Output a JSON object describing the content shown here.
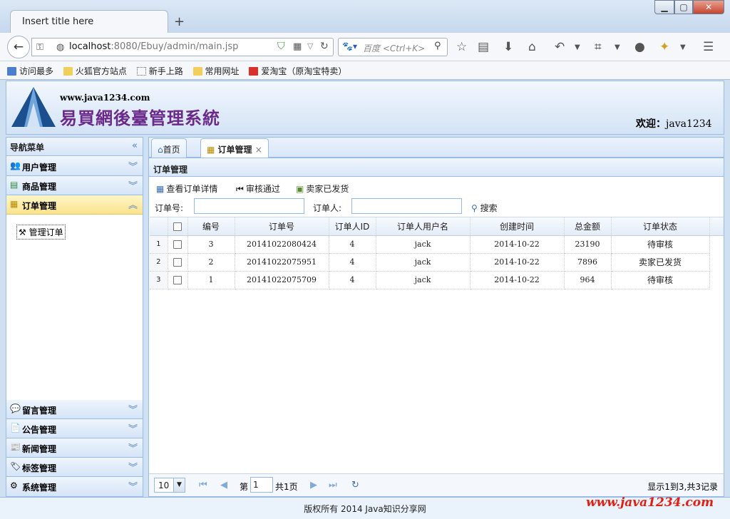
{
  "browser": {
    "tab_title": "Insert title here",
    "new_tab": "+",
    "url_host": "localhost",
    "url_rest": ":8080/Ebuy/admin/main.jsp",
    "search_placeholder": "百度 <Ctrl+K>",
    "bookmarks": [
      "访问最多",
      "火狐官方站点",
      "新手上路",
      "常用网址",
      "爱淘宝（原淘宝特卖）"
    ]
  },
  "header": {
    "site_url": "www.java1234.com",
    "system_title": "易買網後臺管理系統",
    "welcome_label": "欢迎：",
    "username": "java1234"
  },
  "sidebar": {
    "title": "导航菜单",
    "items_top": [
      {
        "label": "用户管理",
        "icon": "users-icon"
      },
      {
        "label": "商品管理",
        "icon": "goods-icon"
      },
      {
        "label": "订单管理",
        "icon": "orders-icon"
      }
    ],
    "active_subitem": "管理订单",
    "items_bottom": [
      {
        "label": "留言管理",
        "icon": "comment-icon"
      },
      {
        "label": "公告管理",
        "icon": "notice-icon"
      },
      {
        "label": "新闻管理",
        "icon": "news-icon"
      },
      {
        "label": "标签管理",
        "icon": "tag-icon"
      },
      {
        "label": "系统管理",
        "icon": "gear-icon"
      }
    ]
  },
  "tabs": [
    {
      "label": "首页",
      "icon": "home-icon"
    },
    {
      "label": "订单管理",
      "icon": "orders-icon",
      "close": "×"
    }
  ],
  "panel": {
    "title": "订单管理",
    "toolbar": {
      "view_detail": "查看订单详情",
      "approve": "审核通过",
      "shipped": "卖家已发货"
    },
    "filter": {
      "order_no_label": "订单号:",
      "orderer_label": "订单人:",
      "search_button": "搜索"
    }
  },
  "grid": {
    "columns": [
      "编号",
      "订单号",
      "订单人ID",
      "订单人用户名",
      "创建时间",
      "总金额",
      "订单状态"
    ],
    "rows": [
      {
        "rownum": "1",
        "id": "3",
        "order_no": "20141022080424",
        "user_id": "4",
        "username": "jack",
        "created": "2014-10-22",
        "total": "23190",
        "status": "待审核"
      },
      {
        "rownum": "2",
        "id": "2",
        "order_no": "20141022075951",
        "user_id": "4",
        "username": "jack",
        "created": "2014-10-22",
        "total": "7896",
        "status": "卖家已发货"
      },
      {
        "rownum": "3",
        "id": "1",
        "order_no": "20141022075709",
        "user_id": "4",
        "username": "jack",
        "created": "2014-10-22",
        "total": "964",
        "status": "待审核"
      }
    ]
  },
  "pager": {
    "page_size": "10",
    "page_prefix": "第",
    "page_value": "1",
    "page_total": "共1页",
    "summary": "显示1到3,共3记录"
  },
  "footer": {
    "copyright": "版权所有 2014 Java知识分享网",
    "watermark": "www.java1234.com"
  }
}
